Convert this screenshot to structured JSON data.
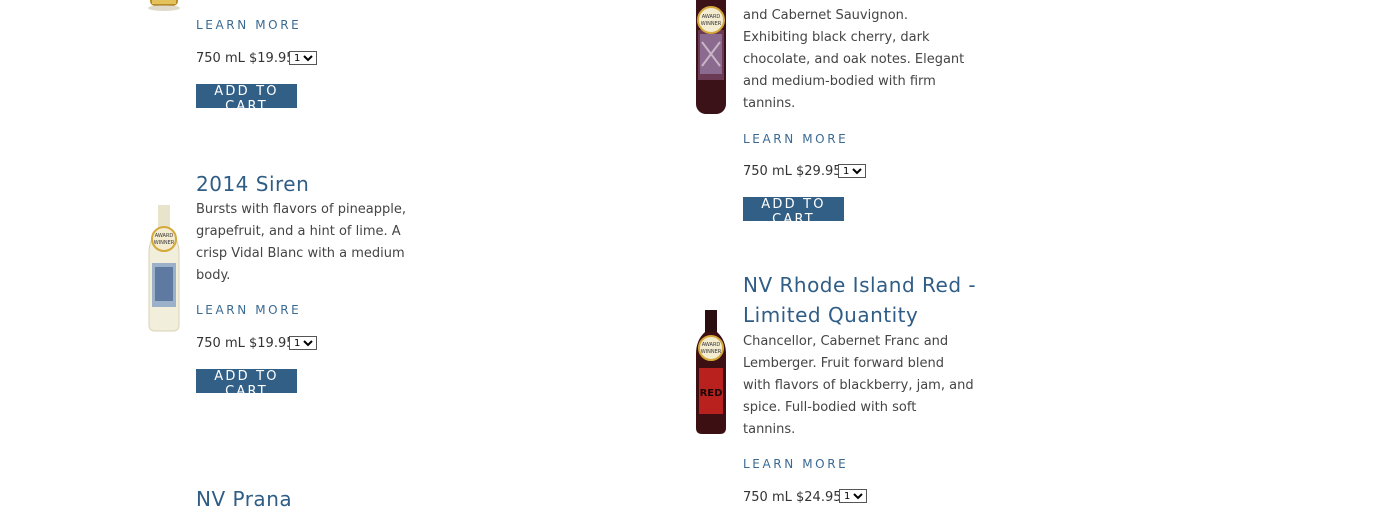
{
  "products": [
    {
      "id": "top-left",
      "learn_more": "LEARN MORE",
      "size": "750 mL",
      "price": "$19.95",
      "qty": "1",
      "add_to_cart": "ADD TO CART"
    },
    {
      "id": "top-right",
      "desc_lines": [
        "and Cabernet Sauvignon.",
        "Exhibiting black cherry, dark",
        "chocolate, and oak notes. Elegant",
        "and medium-bodied with firm",
        "tannins."
      ],
      "badge": [
        "AWARD",
        "WINNER"
      ],
      "learn_more": "LEARN MORE",
      "size": "750 mL",
      "price": "$29.95",
      "qty": "1",
      "add_to_cart": "ADD TO CART"
    },
    {
      "id": "siren",
      "title": "2014 Siren",
      "desc_lines": [
        "Bursts with flavors of pineapple,",
        "grapefruit, and a hint of lime. A",
        "crisp Vidal Blanc with a medium",
        "body."
      ],
      "badge": [
        "AWARD",
        "WINNER"
      ],
      "learn_more": "LEARN MORE",
      "size": "750 mL",
      "price": "$19.95",
      "qty": "1",
      "add_to_cart": "ADD TO CART"
    },
    {
      "id": "rhode-island-red",
      "title_lines": [
        "NV Rhode Island Red -",
        "Limited Quantity"
      ],
      "desc_lines": [
        "Chancellor, Cabernet Franc and",
        "Lemberger. Fruit forward blend",
        "with flavors of blackberry, jam, and",
        "spice. Full-bodied with soft",
        "tannins."
      ],
      "badge": [
        "AWARD",
        "WINNER"
      ],
      "label_text": "RED",
      "learn_more": "LEARN MORE",
      "size": "750 mL",
      "price": "$24.95",
      "qty": "1"
    },
    {
      "id": "prana",
      "title": "NV Prana"
    }
  ],
  "colors": {
    "accent": "#325f86",
    "title": "#2f5d86",
    "badge_gold": "#d4a93a"
  }
}
